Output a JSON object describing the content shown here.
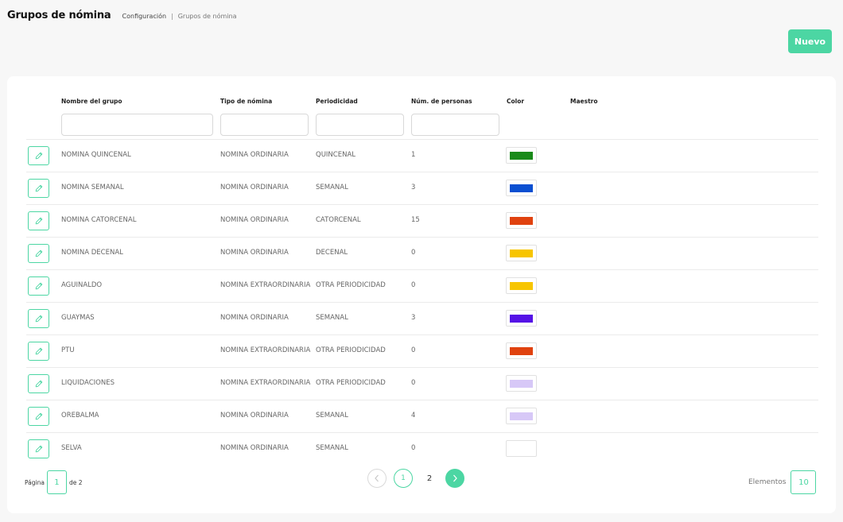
{
  "header": {
    "title": "Grupos de nómina",
    "breadcrumb": {
      "parent": "Configuración",
      "separator": "|",
      "current": "Grupos de nómina"
    }
  },
  "actions": {
    "new_label": "Nuevo"
  },
  "table": {
    "columns": [
      "Nombre del grupo",
      "Tipo de nómina",
      "Periodicidad",
      "Núm. de personas",
      "Color",
      "Maestro"
    ],
    "rows": [
      {
        "nombre": "NÓMINA QUINCENAL",
        "tipo": "NÓMINA ORDINARIA",
        "periodicidad": "QUINCENAL",
        "personas": "1",
        "color": "#1a8a1a"
      },
      {
        "nombre": "NÓMINA SEMANAL",
        "tipo": "NÓMINA ORDINARIA",
        "periodicidad": "SEMANAL",
        "personas": "3",
        "color": "#0a4fd1"
      },
      {
        "nombre": "NÓMINA CATORCENAL",
        "tipo": "NÓMINA ORDINARIA",
        "periodicidad": "CATORCENAL",
        "personas": "15",
        "color": "#e0420f"
      },
      {
        "nombre": "NÓMINA DECENAL",
        "tipo": "NÓMINA ORDINARIA",
        "periodicidad": "DECENAL",
        "personas": "0",
        "color": "#f7c500"
      },
      {
        "nombre": "AGUINALDO",
        "tipo": "NÓMINA EXTRAORDINARIA",
        "periodicidad": "OTRA PERIODICIDAD",
        "personas": "0",
        "color": "#f7c500"
      },
      {
        "nombre": "GUAYMAS",
        "tipo": "NÓMINA ORDINARIA",
        "periodicidad": "SEMANAL",
        "personas": "3",
        "color": "#5512e6"
      },
      {
        "nombre": "PTU",
        "tipo": "NÓMINA EXTRAORDINARIA",
        "periodicidad": "OTRA PERIODICIDAD",
        "personas": "0",
        "color": "#e0420f"
      },
      {
        "nombre": "LIQUIDACIONES",
        "tipo": "NÓMINA EXTRAORDINARIA",
        "periodicidad": "OTRA PERIODICIDAD",
        "personas": "0",
        "color": "#d7c8f7"
      },
      {
        "nombre": "OREBALMA",
        "tipo": "NÓMINA ORDINARIA",
        "periodicidad": "SEMANAL",
        "personas": "4",
        "color": "#d7c8f7"
      },
      {
        "nombre": "SELVA",
        "tipo": "NÓMINA ORDINARIA",
        "periodicidad": "SEMANAL",
        "personas": "0",
        "color": "#ffffff"
      }
    ]
  },
  "pagination": {
    "page_label": "Página",
    "current_page": "1",
    "of_label": "de 2",
    "pages": [
      "1",
      "2"
    ],
    "elements_label": "Elementos",
    "per_page": "10"
  },
  "colors": {
    "accent": "#4cd6a3"
  },
  "icons": {
    "edit": "pencil-icon",
    "prev": "chevron-left-icon",
    "next": "chevron-right-icon"
  }
}
